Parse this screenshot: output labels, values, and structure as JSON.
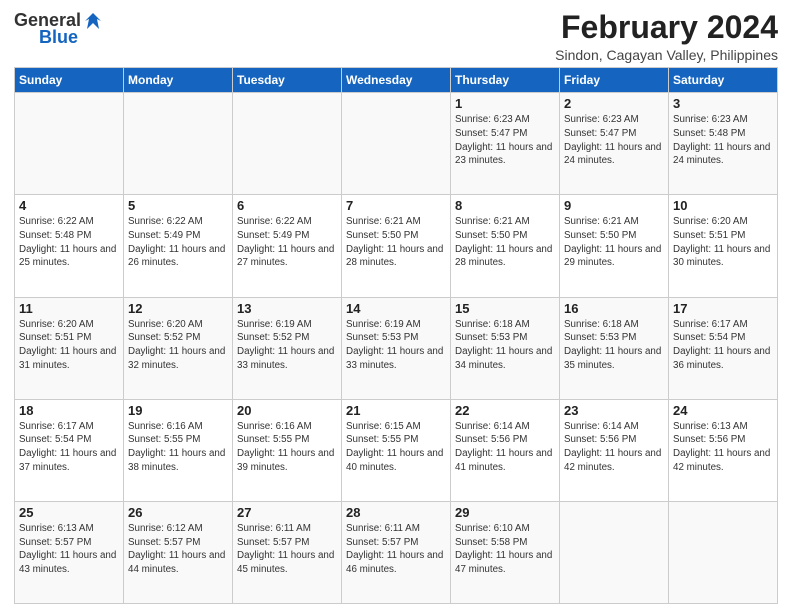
{
  "header": {
    "logo_general": "General",
    "logo_blue": "Blue",
    "month_title": "February 2024",
    "location": "Sindon, Cagayan Valley, Philippines"
  },
  "days_of_week": [
    "Sunday",
    "Monday",
    "Tuesday",
    "Wednesday",
    "Thursday",
    "Friday",
    "Saturday"
  ],
  "weeks": [
    [
      {
        "day": "",
        "info": ""
      },
      {
        "day": "",
        "info": ""
      },
      {
        "day": "",
        "info": ""
      },
      {
        "day": "",
        "info": ""
      },
      {
        "day": "1",
        "info": "Sunrise: 6:23 AM\nSunset: 5:47 PM\nDaylight: 11 hours and 23 minutes."
      },
      {
        "day": "2",
        "info": "Sunrise: 6:23 AM\nSunset: 5:47 PM\nDaylight: 11 hours and 24 minutes."
      },
      {
        "day": "3",
        "info": "Sunrise: 6:23 AM\nSunset: 5:48 PM\nDaylight: 11 hours and 24 minutes."
      }
    ],
    [
      {
        "day": "4",
        "info": "Sunrise: 6:22 AM\nSunset: 5:48 PM\nDaylight: 11 hours and 25 minutes."
      },
      {
        "day": "5",
        "info": "Sunrise: 6:22 AM\nSunset: 5:49 PM\nDaylight: 11 hours and 26 minutes."
      },
      {
        "day": "6",
        "info": "Sunrise: 6:22 AM\nSunset: 5:49 PM\nDaylight: 11 hours and 27 minutes."
      },
      {
        "day": "7",
        "info": "Sunrise: 6:21 AM\nSunset: 5:50 PM\nDaylight: 11 hours and 28 minutes."
      },
      {
        "day": "8",
        "info": "Sunrise: 6:21 AM\nSunset: 5:50 PM\nDaylight: 11 hours and 28 minutes."
      },
      {
        "day": "9",
        "info": "Sunrise: 6:21 AM\nSunset: 5:50 PM\nDaylight: 11 hours and 29 minutes."
      },
      {
        "day": "10",
        "info": "Sunrise: 6:20 AM\nSunset: 5:51 PM\nDaylight: 11 hours and 30 minutes."
      }
    ],
    [
      {
        "day": "11",
        "info": "Sunrise: 6:20 AM\nSunset: 5:51 PM\nDaylight: 11 hours and 31 minutes."
      },
      {
        "day": "12",
        "info": "Sunrise: 6:20 AM\nSunset: 5:52 PM\nDaylight: 11 hours and 32 minutes."
      },
      {
        "day": "13",
        "info": "Sunrise: 6:19 AM\nSunset: 5:52 PM\nDaylight: 11 hours and 33 minutes."
      },
      {
        "day": "14",
        "info": "Sunrise: 6:19 AM\nSunset: 5:53 PM\nDaylight: 11 hours and 33 minutes."
      },
      {
        "day": "15",
        "info": "Sunrise: 6:18 AM\nSunset: 5:53 PM\nDaylight: 11 hours and 34 minutes."
      },
      {
        "day": "16",
        "info": "Sunrise: 6:18 AM\nSunset: 5:53 PM\nDaylight: 11 hours and 35 minutes."
      },
      {
        "day": "17",
        "info": "Sunrise: 6:17 AM\nSunset: 5:54 PM\nDaylight: 11 hours and 36 minutes."
      }
    ],
    [
      {
        "day": "18",
        "info": "Sunrise: 6:17 AM\nSunset: 5:54 PM\nDaylight: 11 hours and 37 minutes."
      },
      {
        "day": "19",
        "info": "Sunrise: 6:16 AM\nSunset: 5:55 PM\nDaylight: 11 hours and 38 minutes."
      },
      {
        "day": "20",
        "info": "Sunrise: 6:16 AM\nSunset: 5:55 PM\nDaylight: 11 hours and 39 minutes."
      },
      {
        "day": "21",
        "info": "Sunrise: 6:15 AM\nSunset: 5:55 PM\nDaylight: 11 hours and 40 minutes."
      },
      {
        "day": "22",
        "info": "Sunrise: 6:14 AM\nSunset: 5:56 PM\nDaylight: 11 hours and 41 minutes."
      },
      {
        "day": "23",
        "info": "Sunrise: 6:14 AM\nSunset: 5:56 PM\nDaylight: 11 hours and 42 minutes."
      },
      {
        "day": "24",
        "info": "Sunrise: 6:13 AM\nSunset: 5:56 PM\nDaylight: 11 hours and 42 minutes."
      }
    ],
    [
      {
        "day": "25",
        "info": "Sunrise: 6:13 AM\nSunset: 5:57 PM\nDaylight: 11 hours and 43 minutes."
      },
      {
        "day": "26",
        "info": "Sunrise: 6:12 AM\nSunset: 5:57 PM\nDaylight: 11 hours and 44 minutes."
      },
      {
        "day": "27",
        "info": "Sunrise: 6:11 AM\nSunset: 5:57 PM\nDaylight: 11 hours and 45 minutes."
      },
      {
        "day": "28",
        "info": "Sunrise: 6:11 AM\nSunset: 5:57 PM\nDaylight: 11 hours and 46 minutes."
      },
      {
        "day": "29",
        "info": "Sunrise: 6:10 AM\nSunset: 5:58 PM\nDaylight: 11 hours and 47 minutes."
      },
      {
        "day": "",
        "info": ""
      },
      {
        "day": "",
        "info": ""
      }
    ]
  ]
}
